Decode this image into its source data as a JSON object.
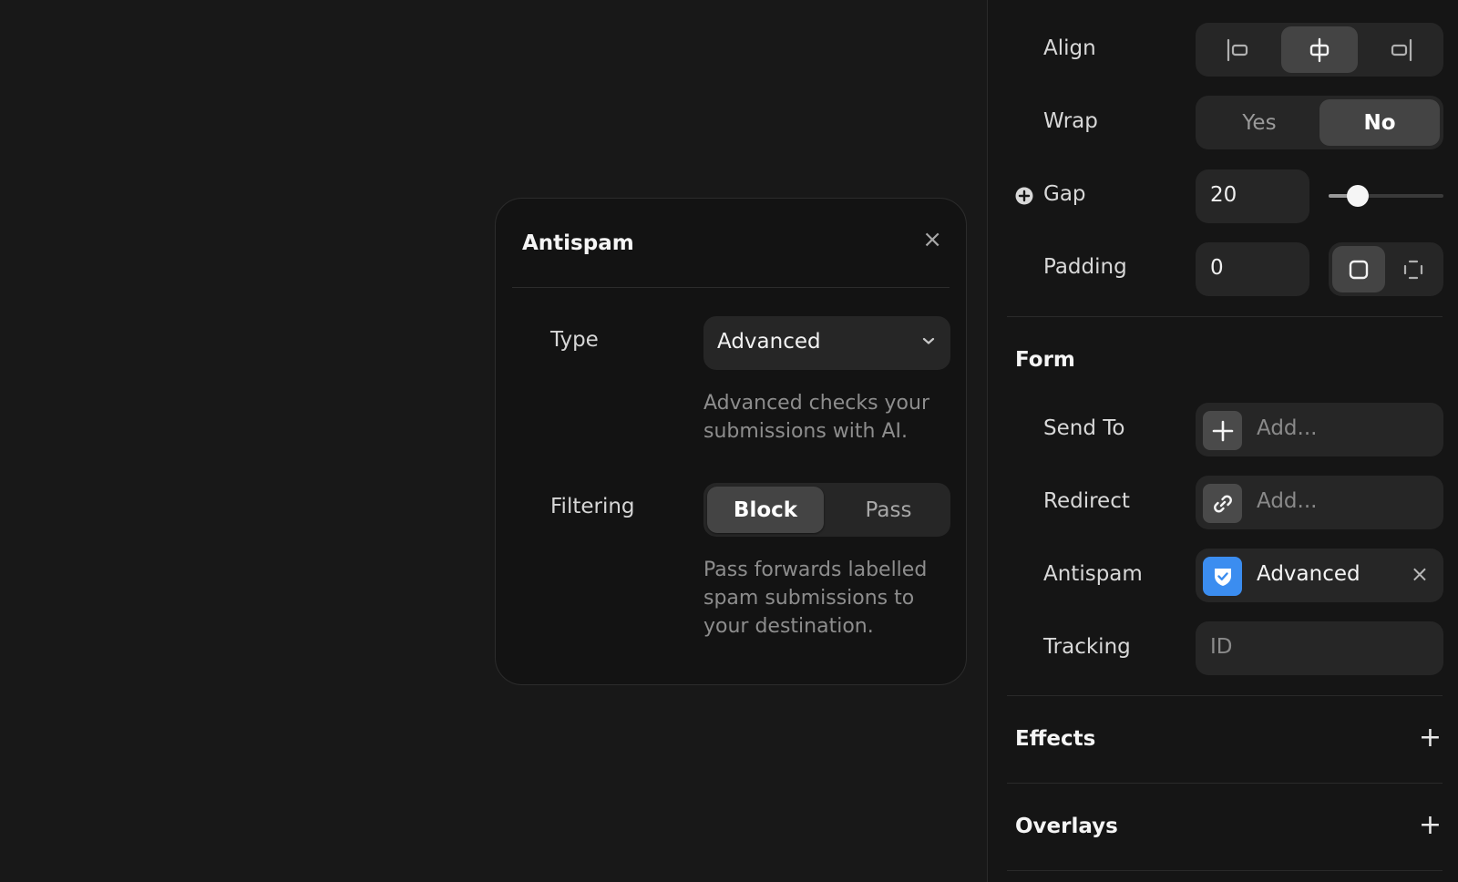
{
  "modal": {
    "title": "Antispam",
    "close_glyph": "×",
    "type_label": "Type",
    "type_value": "Advanced",
    "type_help": "Advanced checks your submissions with AI.",
    "filtering_label": "Filtering",
    "filtering_options": [
      "Block",
      "Pass"
    ],
    "filtering_selected": "Block",
    "filtering_help": "Pass forwards labelled spam submissions to your destination."
  },
  "panel": {
    "align": {
      "label": "Align",
      "selected": "center",
      "icons": [
        "align-left-icon",
        "align-center-icon",
        "align-right-icon"
      ]
    },
    "wrap": {
      "label": "Wrap",
      "options": [
        "Yes",
        "No"
      ],
      "selected": "No"
    },
    "gap": {
      "label": "Gap",
      "value": "20",
      "slider_fraction": 0.25
    },
    "padding": {
      "label": "Padding",
      "value": "0",
      "mode": "uniform"
    },
    "form": {
      "title": "Form",
      "send_to": {
        "label": "Send To",
        "placeholder": "Add..."
      },
      "redirect": {
        "label": "Redirect",
        "placeholder": "Add..."
      },
      "antispam": {
        "label": "Antispam",
        "value": "Advanced",
        "remove_glyph": "×"
      },
      "tracking": {
        "label": "Tracking",
        "placeholder": "ID"
      }
    },
    "effects": {
      "title": "Effects",
      "add_glyph": "+"
    },
    "overlays": {
      "title": "Overlays",
      "add_glyph": "+"
    }
  },
  "colors": {
    "accent_blue": "#3b8df0",
    "active_segment": "#444444",
    "field_bg": "#262626"
  }
}
